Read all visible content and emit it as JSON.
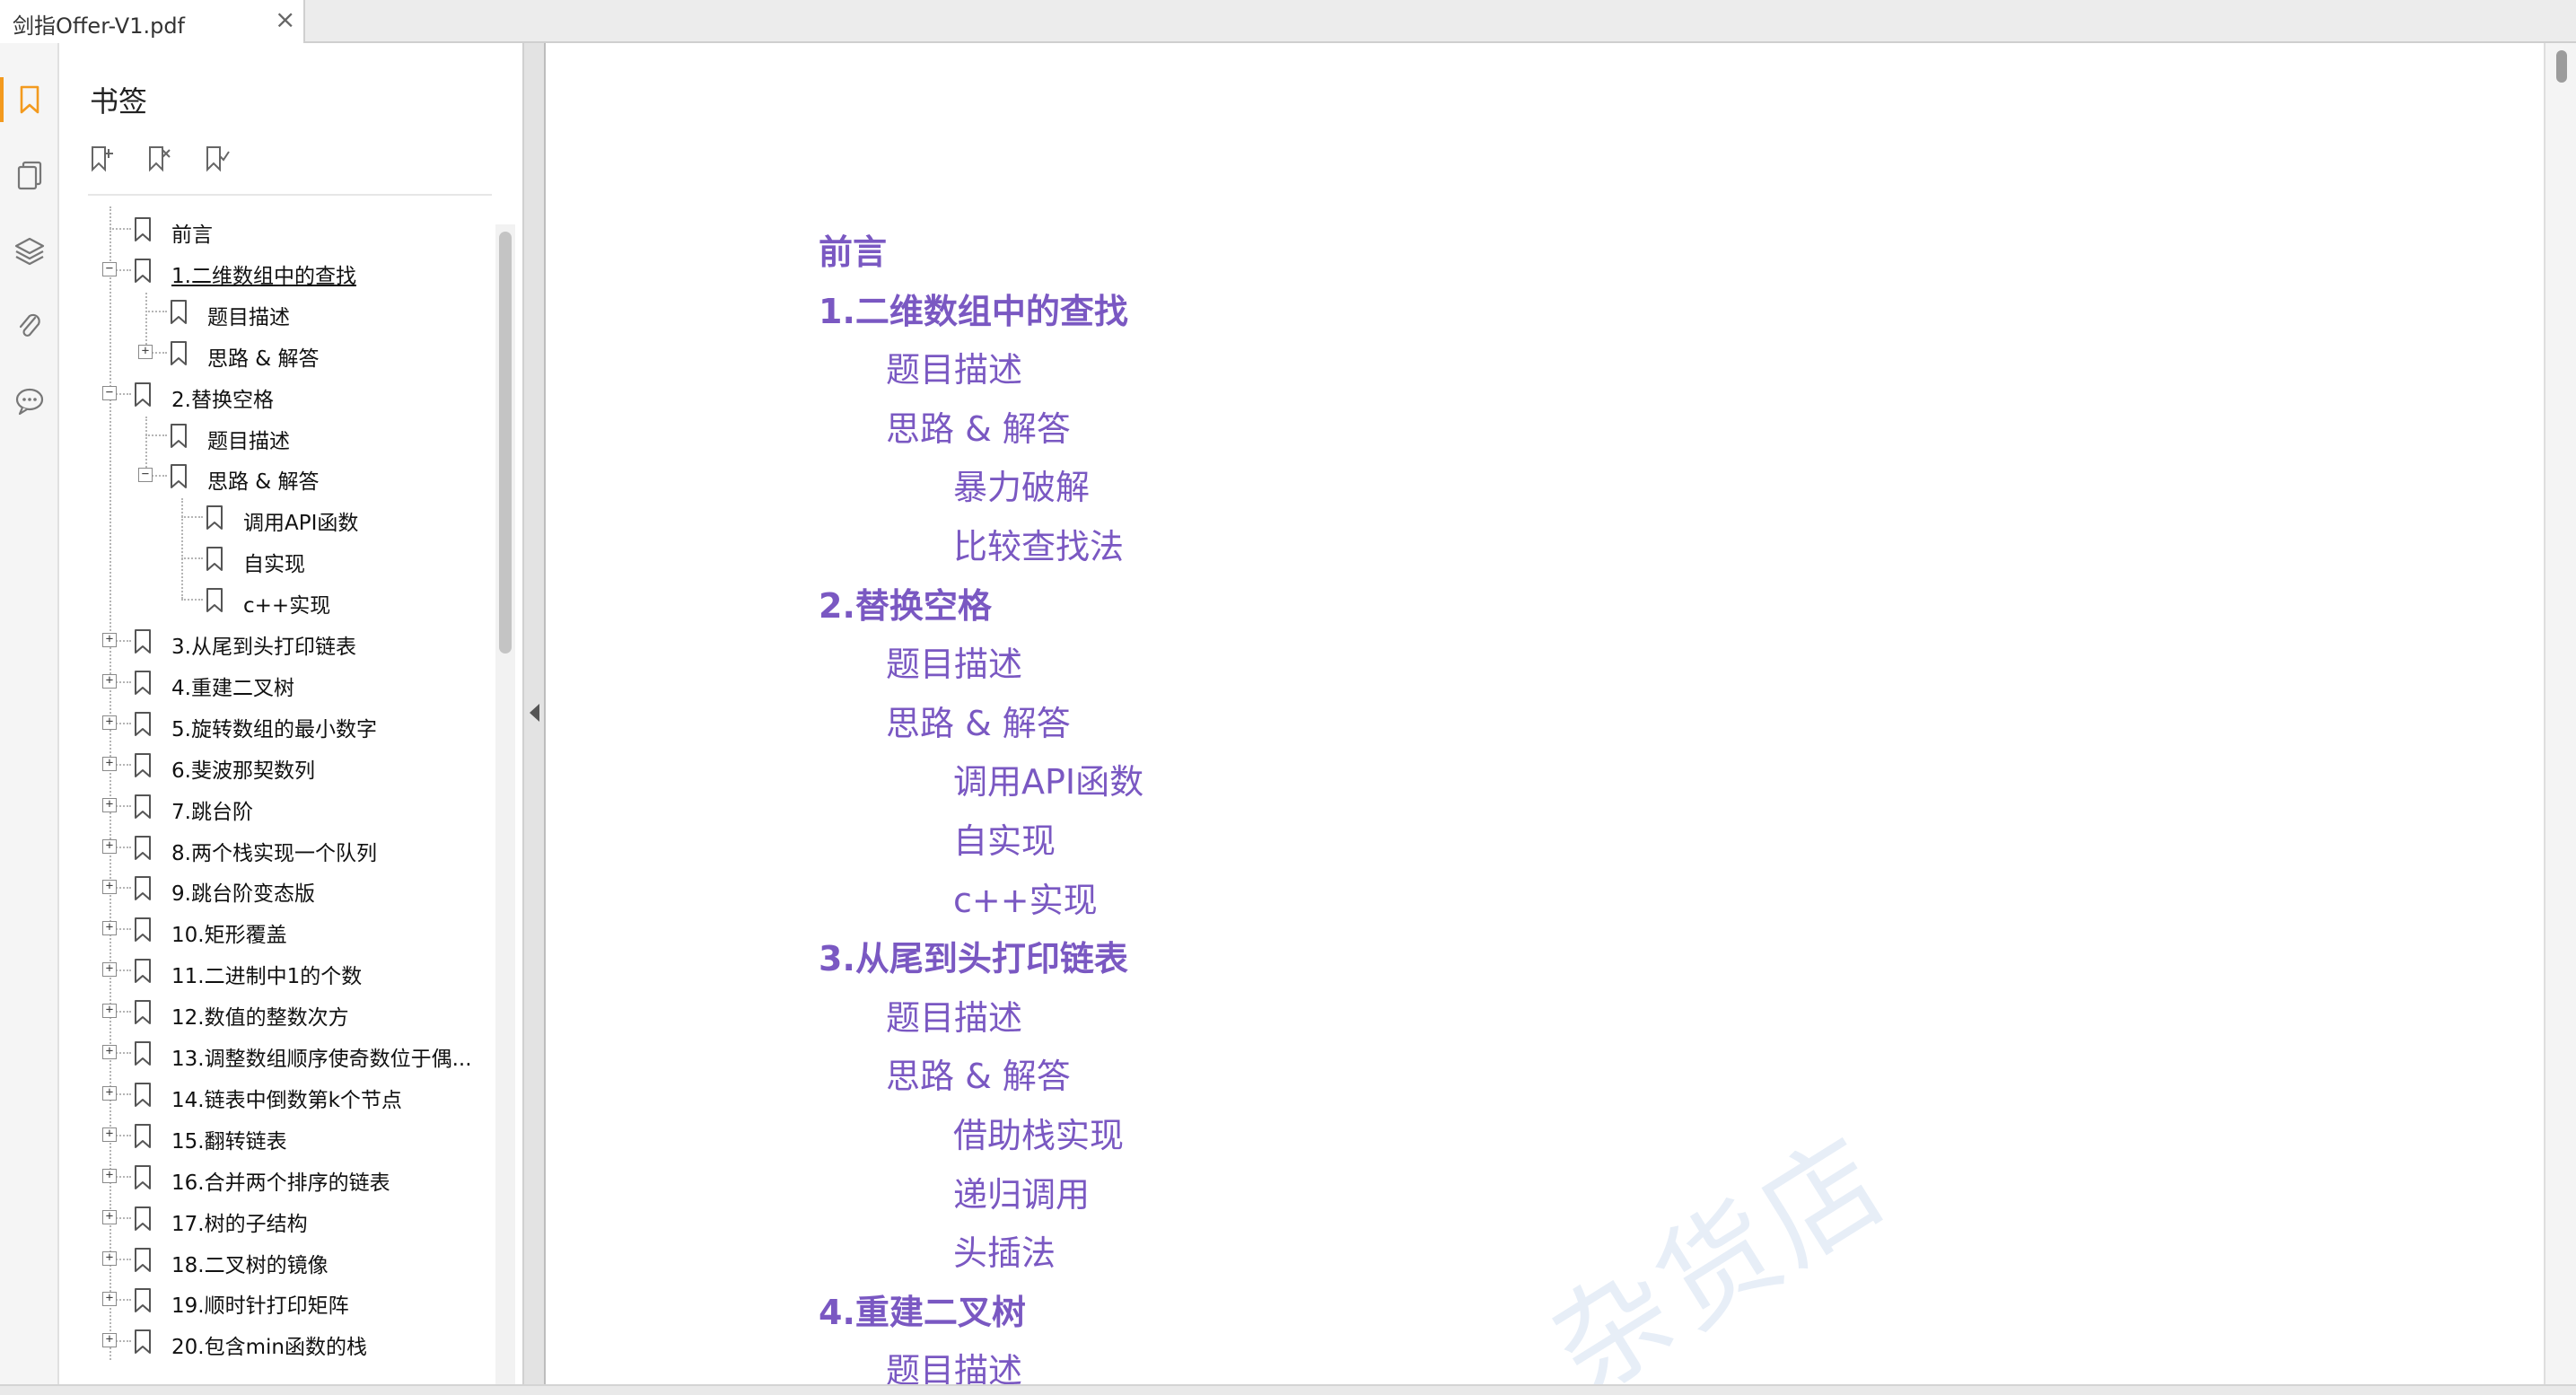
{
  "window": {
    "tab_title": "剑指Offer-V1.pdf",
    "close_glyph": "×"
  },
  "rail": {
    "items": [
      {
        "name": "bookmark-icon",
        "active": true
      },
      {
        "name": "pages-icon",
        "active": false
      },
      {
        "name": "layers-icon",
        "active": false
      },
      {
        "name": "attachment-icon",
        "active": false
      },
      {
        "name": "comment-icon",
        "active": false
      }
    ],
    "accent": "#f39a1e"
  },
  "panel": {
    "title": "书签",
    "tools": [
      "add-bookmark-icon",
      "delete-bookmark-icon",
      "bookmark-settings-icon"
    ]
  },
  "bookmarks": [
    {
      "label": "前言",
      "depth": 0,
      "toggle": ""
    },
    {
      "label": "1.二维数组中的查找",
      "depth": 0,
      "toggle": "−",
      "selected": true
    },
    {
      "label": "题目描述",
      "depth": 1,
      "toggle": ""
    },
    {
      "label": "思路 & 解答",
      "depth": 1,
      "toggle": "+"
    },
    {
      "label": "2.替换空格",
      "depth": 0,
      "toggle": "−"
    },
    {
      "label": "题目描述",
      "depth": 1,
      "toggle": ""
    },
    {
      "label": "思路 & 解答",
      "depth": 1,
      "toggle": "−"
    },
    {
      "label": "调用API函数",
      "depth": 2,
      "toggle": ""
    },
    {
      "label": "自实现",
      "depth": 2,
      "toggle": ""
    },
    {
      "label": "c++实现",
      "depth": 2,
      "toggle": ""
    },
    {
      "label": "3.从尾到头打印链表",
      "depth": 0,
      "toggle": "+"
    },
    {
      "label": "4.重建二叉树",
      "depth": 0,
      "toggle": "+"
    },
    {
      "label": "5.旋转数组的最小数字",
      "depth": 0,
      "toggle": "+"
    },
    {
      "label": "6.斐波那契数列",
      "depth": 0,
      "toggle": "+"
    },
    {
      "label": "7.跳台阶",
      "depth": 0,
      "toggle": "+"
    },
    {
      "label": "8.两个栈实现一个队列",
      "depth": 0,
      "toggle": "+"
    },
    {
      "label": "9.跳台阶变态版",
      "depth": 0,
      "toggle": "+"
    },
    {
      "label": "10.矩形覆盖",
      "depth": 0,
      "toggle": "+"
    },
    {
      "label": "11.二进制中1的个数",
      "depth": 0,
      "toggle": "+"
    },
    {
      "label": "12.数值的整数次方",
      "depth": 0,
      "toggle": "+"
    },
    {
      "label": "13.调整数组顺序使奇数位于偶...",
      "depth": 0,
      "toggle": "+"
    },
    {
      "label": "14.链表中倒数第k个节点",
      "depth": 0,
      "toggle": "+"
    },
    {
      "label": "15.翻转链表",
      "depth": 0,
      "toggle": "+"
    },
    {
      "label": "16.合并两个排序的链表",
      "depth": 0,
      "toggle": "+"
    },
    {
      "label": "17.树的子结构",
      "depth": 0,
      "toggle": "+"
    },
    {
      "label": "18.二叉树的镜像",
      "depth": 0,
      "toggle": "+"
    },
    {
      "label": "19.顺时针打印矩阵",
      "depth": 0,
      "toggle": "+"
    },
    {
      "label": "20.包含min函数的栈",
      "depth": 0,
      "toggle": "+"
    }
  ],
  "document": {
    "text_color": "#7a58c2",
    "toc": [
      {
        "text": "前言",
        "level": 0
      },
      {
        "text": "1.二维数组中的查找",
        "level": 0
      },
      {
        "text": "题目描述",
        "level": 1
      },
      {
        "text": "思路 & 解答",
        "level": 1
      },
      {
        "text": "暴力破解",
        "level": 2
      },
      {
        "text": "比较查找法",
        "level": 2
      },
      {
        "text": "2.替换空格",
        "level": 0
      },
      {
        "text": "题目描述",
        "level": 1
      },
      {
        "text": "思路 & 解答",
        "level": 1
      },
      {
        "text": "调用API函数",
        "level": 2
      },
      {
        "text": "自实现",
        "level": 2
      },
      {
        "text": "c++实现",
        "level": 2
      },
      {
        "text": "3.从尾到头打印链表",
        "level": 0
      },
      {
        "text": "题目描述",
        "level": 1
      },
      {
        "text": "思路 & 解答",
        "level": 1
      },
      {
        "text": "借助栈实现",
        "level": 2
      },
      {
        "text": "递归调用",
        "level": 2
      },
      {
        "text": "头插法",
        "level": 2
      },
      {
        "text": "4.重建二叉树",
        "level": 0
      },
      {
        "text": "题目描述",
        "level": 1
      }
    ],
    "watermark": "杂货店"
  }
}
